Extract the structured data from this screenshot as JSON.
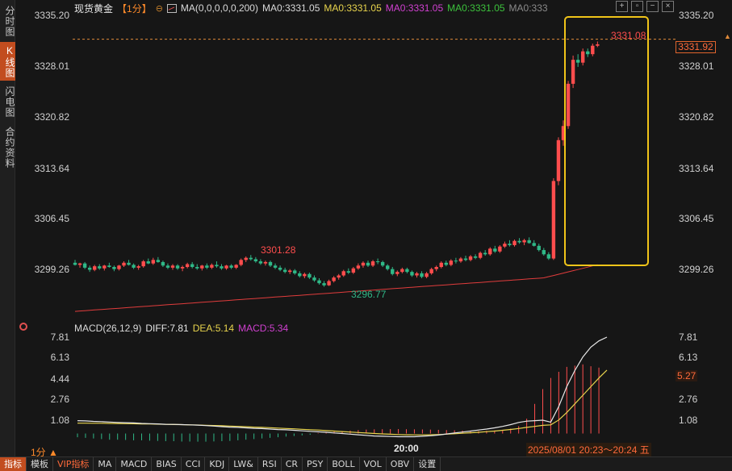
{
  "sidebar": {
    "tabs": [
      {
        "label": "分时图",
        "active": false
      },
      {
        "label": "K线图",
        "active": true
      },
      {
        "label": "闪电图",
        "active": false
      },
      {
        "label": "合约资料",
        "active": false
      }
    ]
  },
  "header": {
    "title": "现货黄金",
    "period": "【1分】",
    "ma_params": "MA(0,0,0,0,0,200)",
    "ma_values": [
      {
        "text": "MA0:3331.05",
        "color": "#d9d9d9"
      },
      {
        "text": "MA0:3331.05",
        "color": "#e8d44d"
      },
      {
        "text": "MA0:3331.05",
        "color": "#d040d0"
      },
      {
        "text": "MA0:3331.05",
        "color": "#3cc23c"
      },
      {
        "text": "MA0:333",
        "color": "#8a8a8a"
      }
    ]
  },
  "window_controls": [
    "+",
    "▫",
    "−",
    "×"
  ],
  "price_axis": {
    "ticks": [
      "3335.20",
      "3328.01",
      "3320.82",
      "3313.64",
      "3306.45",
      "3299.26"
    ],
    "current_price": "3331.92",
    "current_price_color": "#ff6a3a"
  },
  "macd_panel": {
    "params": "MACD(26,12,9)",
    "diff": {
      "text": "DIFF:7.81",
      "color": "#e8e8e8"
    },
    "dea": {
      "text": "DEA:5.14",
      "color": "#e8d44d"
    },
    "macd": {
      "text": "MACD:5.34",
      "color": "#d040d0"
    },
    "ticks": [
      "7.81",
      "6.13",
      "4.44",
      "2.76",
      "1.08"
    ],
    "current_value": "5.27"
  },
  "bottom": {
    "period_selector": "1分 ▲",
    "time_label": "20:00",
    "range_label": "2025/08/01 20:23～20:24 五",
    "tabs": [
      {
        "label": "指标",
        "active": true
      },
      {
        "label": "模板",
        "active": false
      },
      {
        "label": "VIP指标",
        "vip": true
      },
      {
        "label": "MA"
      },
      {
        "label": "MACD"
      },
      {
        "label": "BIAS"
      },
      {
        "label": "CCI"
      },
      {
        "label": "KDJ"
      },
      {
        "label": "LW&"
      },
      {
        "label": "RSI"
      },
      {
        "label": "CR"
      },
      {
        "label": "PSY"
      },
      {
        "label": "BOLL"
      },
      {
        "label": "VOL"
      },
      {
        "label": "OBV"
      },
      {
        "label": "设置"
      }
    ]
  },
  "colors": {
    "up": "#ff4d4d",
    "down": "#2fb887",
    "ma200": "#e03c3c",
    "highlight_box": "#f0c419",
    "dashed_level": "#e08a3a",
    "diff_line": "#e8e8e8",
    "dea_line": "#e8d44d"
  },
  "chart_data": [
    {
      "type": "candlestick",
      "title": "现货黄金【1分】",
      "ylim": [
        3294.5,
        3336.5
      ],
      "annotations": [
        {
          "label": "3301.28",
          "kind": "high"
        },
        {
          "label": "3296.77",
          "kind": "low"
        },
        {
          "label": "3331.08",
          "kind": "high"
        }
      ],
      "candles": [
        [
          3300.2,
          3300.6,
          3299.8,
          3299.9
        ],
        [
          3299.9,
          3300.2,
          3299.5,
          3300.1
        ],
        [
          3300.1,
          3300.3,
          3299.3,
          3299.5
        ],
        [
          3299.5,
          3299.8,
          3298.9,
          3299.2
        ],
        [
          3299.2,
          3299.9,
          3299.0,
          3299.7
        ],
        [
          3299.7,
          3300.0,
          3299.2,
          3299.4
        ],
        [
          3299.4,
          3299.9,
          3299.1,
          3299.8
        ],
        [
          3299.8,
          3300.2,
          3299.5,
          3299.6
        ],
        [
          3299.6,
          3299.8,
          3299.0,
          3299.3
        ],
        [
          3299.3,
          3299.9,
          3299.1,
          3299.8
        ],
        [
          3299.8,
          3300.4,
          3299.6,
          3300.2
        ],
        [
          3300.2,
          3300.6,
          3299.8,
          3299.9
        ],
        [
          3299.9,
          3300.1,
          3299.3,
          3299.5
        ],
        [
          3299.5,
          3299.9,
          3299.2,
          3299.7
        ],
        [
          3299.7,
          3300.6,
          3299.5,
          3300.4
        ],
        [
          3300.4,
          3300.8,
          3300.0,
          3300.1
        ],
        [
          3300.1,
          3300.9,
          3299.9,
          3300.6
        ],
        [
          3300.6,
          3301.0,
          3300.2,
          3300.3
        ],
        [
          3300.3,
          3300.5,
          3299.6,
          3299.8
        ],
        [
          3299.8,
          3300.1,
          3299.3,
          3299.5
        ],
        [
          3299.5,
          3300.0,
          3299.2,
          3299.8
        ],
        [
          3299.8,
          3300.0,
          3299.2,
          3299.4
        ],
        [
          3299.4,
          3299.8,
          3299.0,
          3299.6
        ],
        [
          3299.6,
          3300.2,
          3299.4,
          3300.0
        ],
        [
          3300.0,
          3300.3,
          3299.4,
          3299.6
        ],
        [
          3299.6,
          3300.0,
          3299.2,
          3299.4
        ],
        [
          3299.4,
          3299.9,
          3299.1,
          3299.8
        ],
        [
          3299.8,
          3300.1,
          3299.3,
          3299.5
        ],
        [
          3299.5,
          3300.1,
          3299.3,
          3299.9
        ],
        [
          3299.9,
          3300.4,
          3299.5,
          3299.7
        ],
        [
          3299.7,
          3300.0,
          3299.2,
          3299.4
        ],
        [
          3299.4,
          3299.9,
          3299.2,
          3299.8
        ],
        [
          3299.8,
          3300.0,
          3299.3,
          3299.5
        ],
        [
          3299.5,
          3300.0,
          3299.3,
          3299.9
        ],
        [
          3299.9,
          3300.8,
          3299.7,
          3300.6
        ],
        [
          3300.6,
          3301.1,
          3300.3,
          3300.9
        ],
        [
          3300.9,
          3301.3,
          3300.5,
          3300.7
        ],
        [
          3300.7,
          3301.0,
          3300.2,
          3300.4
        ],
        [
          3300.4,
          3300.7,
          3299.9,
          3300.1
        ],
        [
          3300.1,
          3300.5,
          3299.8,
          3300.3
        ],
        [
          3300.3,
          3300.5,
          3299.6,
          3299.8
        ],
        [
          3299.8,
          3300.1,
          3299.3,
          3299.5
        ],
        [
          3299.5,
          3299.8,
          3299.0,
          3299.2
        ],
        [
          3299.2,
          3299.5,
          3298.7,
          3298.9
        ],
        [
          3298.9,
          3299.3,
          3298.6,
          3299.1
        ],
        [
          3299.1,
          3299.3,
          3298.5,
          3298.7
        ],
        [
          3298.7,
          3299.0,
          3298.1,
          3298.3
        ],
        [
          3298.3,
          3298.8,
          3298.0,
          3298.6
        ],
        [
          3298.6,
          3298.8,
          3297.9,
          3298.1
        ],
        [
          3298.1,
          3298.4,
          3297.5,
          3297.7
        ],
        [
          3297.7,
          3298.0,
          3297.1,
          3297.3
        ],
        [
          3297.3,
          3297.6,
          3296.8,
          3297.0
        ],
        [
          3297.0,
          3297.8,
          3296.9,
          3297.6
        ],
        [
          3297.6,
          3298.3,
          3297.4,
          3298.1
        ],
        [
          3298.1,
          3298.6,
          3297.8,
          3298.4
        ],
        [
          3298.4,
          3299.2,
          3298.2,
          3299.0
        ],
        [
          3299.0,
          3299.4,
          3298.6,
          3298.8
        ],
        [
          3298.8,
          3299.6,
          3298.6,
          3299.4
        ],
        [
          3299.4,
          3300.1,
          3299.2,
          3299.8
        ],
        [
          3299.8,
          3300.4,
          3299.5,
          3300.2
        ],
        [
          3300.2,
          3300.5,
          3299.6,
          3299.8
        ],
        [
          3299.8,
          3300.6,
          3299.6,
          3300.4
        ],
        [
          3300.4,
          3300.8,
          3300.0,
          3300.3
        ],
        [
          3300.3,
          3300.5,
          3299.6,
          3299.8
        ],
        [
          3299.8,
          3300.0,
          3299.1,
          3299.3
        ],
        [
          3299.3,
          3299.6,
          3298.4,
          3298.6
        ],
        [
          3298.6,
          3299.1,
          3298.3,
          3298.9
        ],
        [
          3298.9,
          3299.5,
          3298.7,
          3299.3
        ],
        [
          3299.3,
          3299.5,
          3298.7,
          3298.9
        ],
        [
          3298.9,
          3299.1,
          3298.2,
          3298.4
        ],
        [
          3298.4,
          3298.9,
          3298.1,
          3298.7
        ],
        [
          3298.7,
          3299.0,
          3298.0,
          3298.2
        ],
        [
          3298.2,
          3298.9,
          3298.0,
          3298.7
        ],
        [
          3298.7,
          3299.5,
          3298.5,
          3299.3
        ],
        [
          3299.3,
          3299.8,
          3299.0,
          3299.6
        ],
        [
          3299.6,
          3300.4,
          3299.4,
          3300.2
        ],
        [
          3300.2,
          3300.5,
          3299.7,
          3299.9
        ],
        [
          3299.9,
          3300.7,
          3299.7,
          3300.5
        ],
        [
          3300.5,
          3300.9,
          3300.1,
          3300.4
        ],
        [
          3300.4,
          3301.0,
          3300.2,
          3300.8
        ],
        [
          3300.8,
          3301.2,
          3300.4,
          3300.6
        ],
        [
          3300.6,
          3301.3,
          3300.4,
          3301.1
        ],
        [
          3301.1,
          3301.4,
          3300.7,
          3300.9
        ],
        [
          3300.9,
          3301.8,
          3300.7,
          3301.6
        ],
        [
          3301.6,
          3302.0,
          3301.2,
          3301.4
        ],
        [
          3301.4,
          3302.4,
          3301.2,
          3302.2
        ],
        [
          3302.2,
          3302.6,
          3301.6,
          3301.8
        ],
        [
          3301.8,
          3302.7,
          3301.6,
          3302.5
        ],
        [
          3302.5,
          3303.2,
          3302.3,
          3302.9
        ],
        [
          3302.9,
          3303.4,
          3302.5,
          3302.7
        ],
        [
          3302.7,
          3303.5,
          3302.5,
          3303.3
        ],
        [
          3303.3,
          3303.7,
          3302.9,
          3303.1
        ],
        [
          3303.1,
          3303.6,
          3302.7,
          3303.4
        ],
        [
          3303.4,
          3303.8,
          3302.9,
          3303.0
        ],
        [
          3303.0,
          3303.4,
          3302.5,
          3302.6
        ],
        [
          3302.6,
          3302.9,
          3301.8,
          3302.0
        ],
        [
          3302.0,
          3302.3,
          3301.2,
          3301.4
        ],
        [
          3301.4,
          3301.7,
          3300.6,
          3300.8
        ],
        [
          3300.8,
          3312.2,
          3300.6,
          3311.8
        ],
        [
          3311.8,
          3318.0,
          3311.2,
          3317.6
        ],
        [
          3317.6,
          3320.4,
          3316.8,
          3319.6
        ],
        [
          3319.6,
          3326.0,
          3319.2,
          3325.6
        ],
        [
          3325.6,
          3329.6,
          3325.0,
          3329.0
        ],
        [
          3329.0,
          3329.8,
          3328.0,
          3328.6
        ],
        [
          3328.6,
          3330.6,
          3328.2,
          3330.2
        ],
        [
          3330.2,
          3330.6,
          3329.4,
          3329.8
        ],
        [
          3329.8,
          3331.3,
          3329.5,
          3331.0
        ],
        [
          3331.0,
          3331.6,
          3330.8,
          3331.2
        ]
      ]
    },
    {
      "type": "line",
      "ylim": [
        -1.5,
        8.2
      ],
      "series": [
        {
          "name": "DIFF",
          "values": [
            1.04,
            1.02,
            0.98,
            0.96,
            0.93,
            0.9,
            0.88,
            0.86,
            0.82,
            0.8,
            0.78,
            0.75,
            0.74,
            0.72,
            0.7,
            0.68,
            0.64,
            0.6,
            0.56,
            0.52,
            0.5,
            0.46,
            0.42,
            0.4,
            0.36,
            0.32,
            0.3,
            0.26,
            0.22,
            0.18,
            0.14,
            0.1,
            0.05,
            0.0,
            -0.05,
            -0.1,
            -0.15,
            -0.2,
            -0.22,
            -0.24,
            -0.26,
            -0.26,
            -0.26,
            -0.22,
            -0.18,
            -0.12,
            -0.04,
            0.04,
            0.12,
            0.2,
            0.28,
            0.36,
            0.46,
            0.58,
            0.72,
            0.9,
            1.0,
            1.04,
            1.08,
            0.92,
            2.2,
            3.8,
            5.1,
            6.2,
            7.0,
            7.5,
            7.81
          ]
        },
        {
          "name": "DEA",
          "values": [
            0.84,
            0.84,
            0.83,
            0.83,
            0.82,
            0.81,
            0.8,
            0.79,
            0.78,
            0.77,
            0.76,
            0.74,
            0.73,
            0.72,
            0.7,
            0.69,
            0.67,
            0.65,
            0.63,
            0.6,
            0.58,
            0.55,
            0.52,
            0.5,
            0.47,
            0.44,
            0.41,
            0.38,
            0.34,
            0.31,
            0.28,
            0.24,
            0.2,
            0.16,
            0.12,
            0.08,
            0.04,
            0.0,
            -0.03,
            -0.06,
            -0.08,
            -0.1,
            -0.11,
            -0.11,
            -0.1,
            -0.08,
            -0.05,
            -0.02,
            0.02,
            0.06,
            0.1,
            0.15,
            0.2,
            0.26,
            0.33,
            0.41,
            0.5,
            0.58,
            0.66,
            0.7,
            1.1,
            1.7,
            2.4,
            3.1,
            3.8,
            4.5,
            5.14
          ]
        },
        {
          "name": "MACD",
          "values": [
            -0.3,
            -0.35,
            -0.4,
            -0.45,
            -0.5,
            -0.5,
            -0.52,
            -0.55,
            -0.55,
            -0.58,
            -0.6,
            -0.62,
            -0.62,
            -0.65,
            -0.65,
            -0.66,
            -0.66,
            -0.64,
            -0.62,
            -0.6,
            -0.55,
            -0.5,
            -0.45,
            -0.4,
            -0.35,
            -0.3,
            -0.25,
            -0.2,
            -0.15,
            -0.1,
            0.05,
            0.1,
            0.15,
            0.2,
            0.24,
            0.28,
            0.32,
            0.34,
            0.35,
            0.36,
            0.36,
            0.35,
            0.34,
            0.33,
            0.32,
            0.3,
            0.28,
            0.26,
            0.24,
            0.22,
            0.2,
            0.22,
            0.25,
            0.3,
            0.4,
            0.6,
            1.2,
            2.4,
            3.6,
            4.5,
            5.0,
            5.4,
            5.5,
            5.6,
            5.45,
            5.34
          ]
        }
      ]
    }
  ]
}
